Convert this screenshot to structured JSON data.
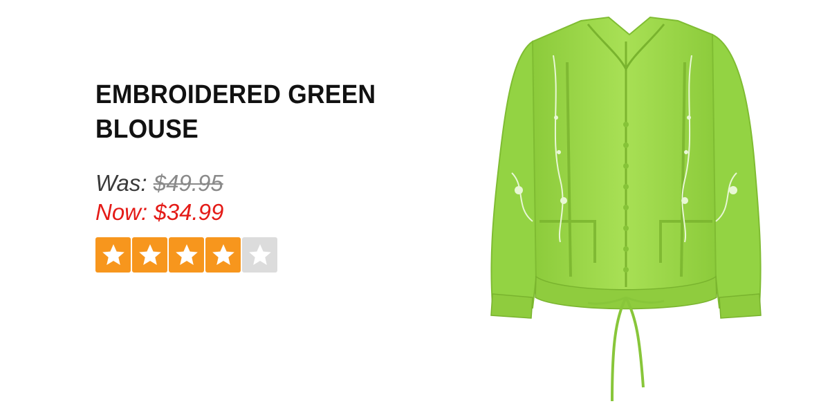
{
  "product": {
    "title": "EMBROIDERED GREEN BLOUSE",
    "was_label": "Was:",
    "was_price": "$49.95",
    "now_label": "Now:",
    "now_price": "$34.99",
    "rating": {
      "value": 4,
      "max": 5
    },
    "image_icon": "green-blouse-image"
  },
  "colors": {
    "accent_star": "#f7961d",
    "star_empty": "#dcdcdc",
    "sale_price": "#e41b17",
    "blouse_green": "#9fd94a"
  }
}
